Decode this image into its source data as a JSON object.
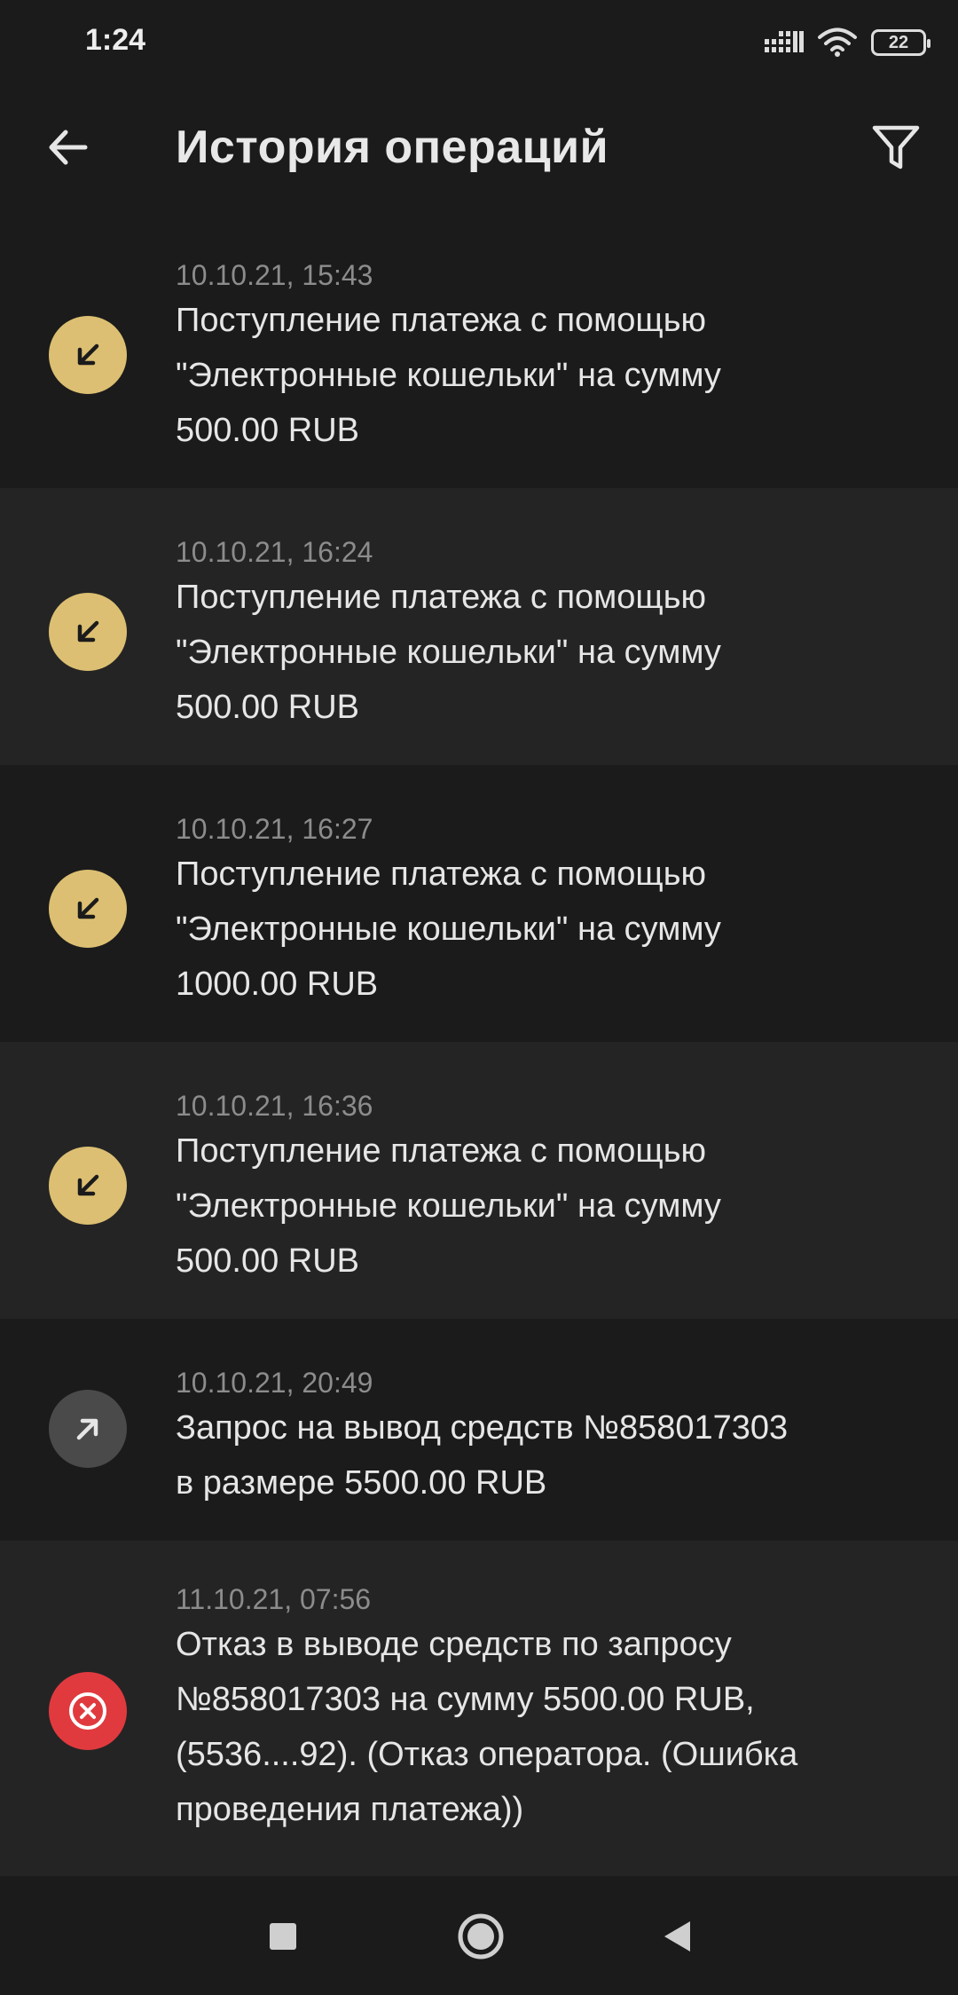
{
  "status_bar": {
    "time": "1:24",
    "battery": "22",
    "icons": [
      "signal-icon",
      "wifi-icon",
      "battery-icon"
    ]
  },
  "header": {
    "title": "История операций",
    "back_icon": "arrow-left-icon",
    "filter_icon": "filter-icon"
  },
  "colors": {
    "background": "#1b1b1b",
    "row_alt": "#242424",
    "incoming": "#dcbf72",
    "outgoing": "#4a4a4a",
    "error": "#e03a3f"
  },
  "operations": [
    {
      "type": "incoming",
      "icon": "arrow-down-left-icon",
      "date": "10.10.21, 15:43",
      "text_lines": [
        "Поступление платежа с помощью",
        "\"Электронные кошельки\" на сумму",
        "500.00 RUB"
      ]
    },
    {
      "type": "incoming",
      "icon": "arrow-down-left-icon",
      "date": "10.10.21, 16:24",
      "text_lines": [
        "Поступление платежа с помощью",
        "\"Электронные кошельки\" на сумму",
        "500.00 RUB"
      ]
    },
    {
      "type": "incoming",
      "icon": "arrow-down-left-icon",
      "date": "10.10.21, 16:27",
      "text_lines": [
        "Поступление платежа с помощью",
        "\"Электронные кошельки\" на сумму",
        "1000.00 RUB"
      ]
    },
    {
      "type": "incoming",
      "icon": "arrow-down-left-icon",
      "date": "10.10.21, 16:36",
      "text_lines": [
        "Поступление платежа с помощью",
        "\"Электронные кошельки\" на сумму",
        "500.00 RUB"
      ]
    },
    {
      "type": "outgoing",
      "icon": "arrow-up-right-icon",
      "date": "10.10.21, 20:49",
      "text_lines": [
        "Запрос на вывод средств №858017303",
        "в размере 5500.00 RUB"
      ]
    },
    {
      "type": "error",
      "icon": "close-circle-icon",
      "date": "11.10.21, 07:56",
      "text_lines": [
        "Отказ в выводе средств по запросу",
        "№858017303 на сумму 5500.00 RUB,",
        "(5536....92). (Отказ оператора. (Ошибка",
        "проведения платежа))"
      ]
    }
  ],
  "nav_bar": {
    "icons": [
      "recent-apps-icon",
      "home-icon",
      "back-icon"
    ]
  }
}
